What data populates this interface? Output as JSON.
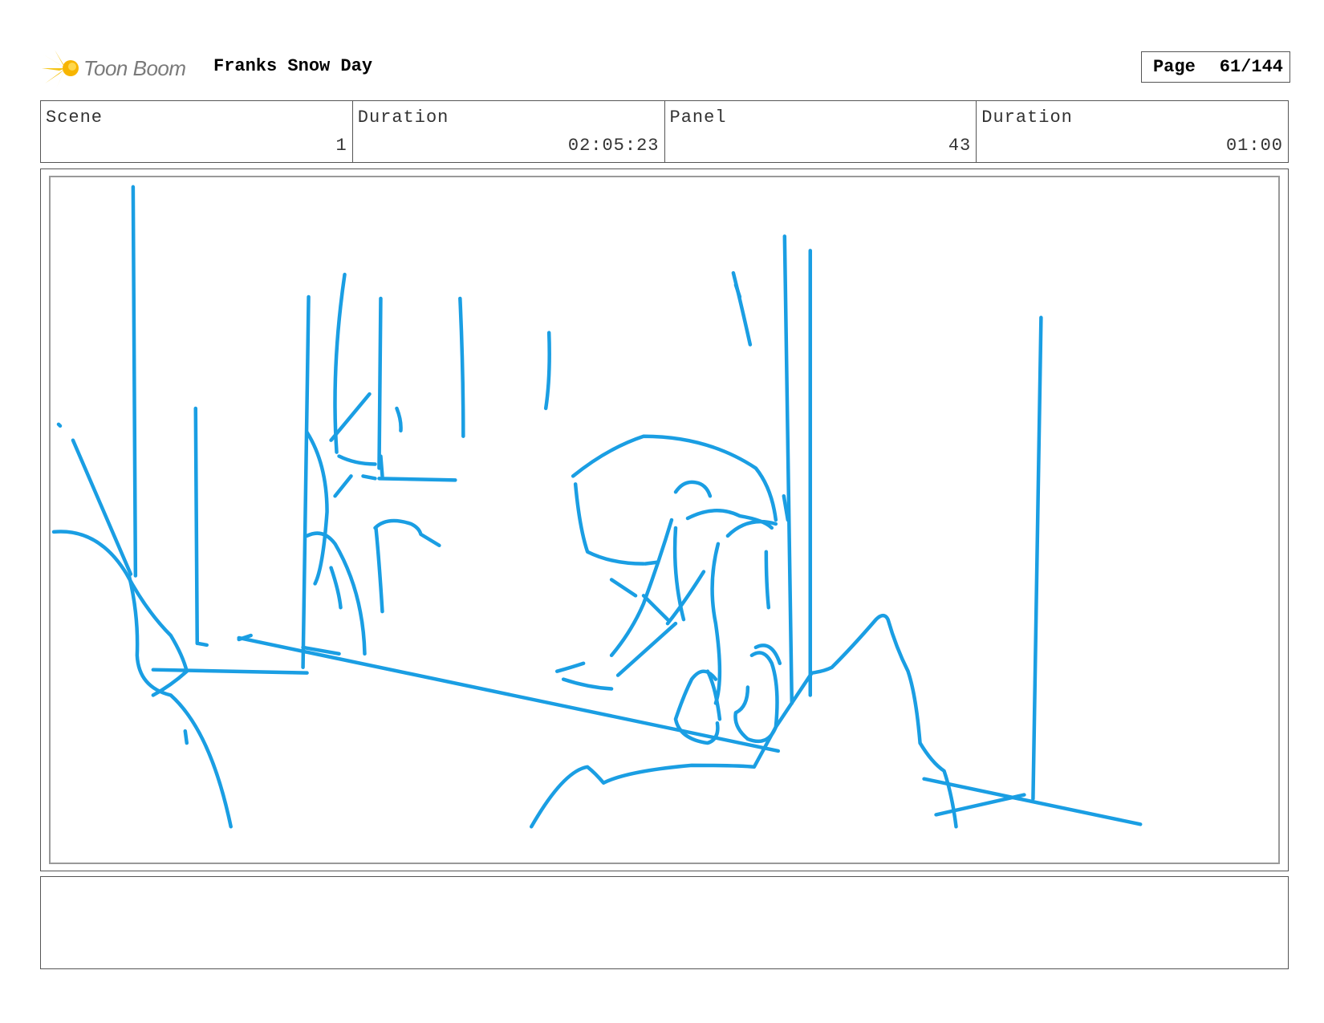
{
  "header": {
    "logo_text": "Toon Boom",
    "project_title": "Franks Snow Day",
    "page_label": "Page",
    "page_number": "61/144"
  },
  "info": {
    "scene_label": "Scene",
    "scene_value": "1",
    "scene_duration_label": "Duration",
    "scene_duration_value": "02:05:23",
    "panel_label": "Panel",
    "panel_value": "43",
    "panel_duration_label": "Duration",
    "panel_duration_value": "01:00"
  },
  "colors": {
    "sketch_stroke": "#1a9ee3",
    "logo_accent": "#f5c518",
    "border": "#555555"
  },
  "notes": {
    "text": ""
  }
}
